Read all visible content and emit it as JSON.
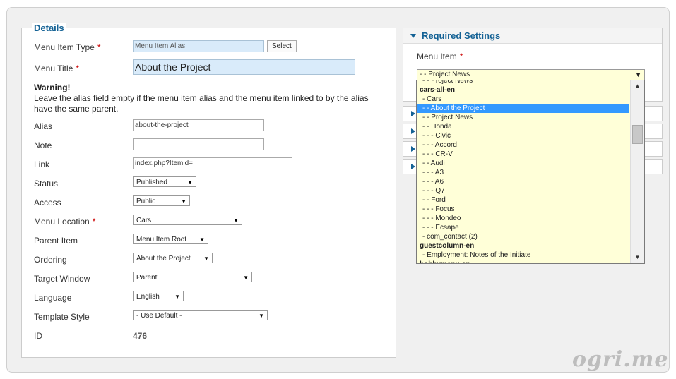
{
  "details": {
    "legend": "Details",
    "menu_item_type": {
      "label": "Menu Item Type",
      "value": "Menu Item Alias",
      "button": "Select"
    },
    "menu_title": {
      "label": "Menu Title",
      "value": "About the Project"
    },
    "warning": {
      "title": "Warning!",
      "text": "Leave the alias field empty if the menu item alias and the menu item linked to by the alias have the same parent."
    },
    "alias": {
      "label": "Alias",
      "value": "about-the-project"
    },
    "note": {
      "label": "Note",
      "value": ""
    },
    "link": {
      "label": "Link",
      "value": "index.php?Itemid="
    },
    "status": {
      "label": "Status",
      "value": "Published"
    },
    "access": {
      "label": "Access",
      "value": "Public"
    },
    "menu_location": {
      "label": "Menu Location",
      "value": "Cars"
    },
    "parent_item": {
      "label": "Parent Item",
      "value": "Menu Item Root"
    },
    "ordering": {
      "label": "Ordering",
      "value": "About the Project"
    },
    "target_window": {
      "label": "Target Window",
      "value": "Parent"
    },
    "language": {
      "label": "Language",
      "value": "English"
    },
    "template_style": {
      "label": "Template Style",
      "value": "- Use Default -"
    },
    "id": {
      "label": "ID",
      "value": "476"
    },
    "required_mark": "*"
  },
  "required_settings": {
    "title": "Required Settings",
    "menu_item_label": "Menu Item",
    "menu_item_value": "- - Project News",
    "dropdown_options": [
      {
        "text": "- - Project News",
        "type": "item"
      },
      {
        "text": "cars-all-en",
        "type": "group"
      },
      {
        "text": "- Cars",
        "type": "item"
      },
      {
        "text": "- - About the Project",
        "type": "selected"
      },
      {
        "text": "- - Project News",
        "type": "item"
      },
      {
        "text": "- - Honda",
        "type": "item"
      },
      {
        "text": "- - - Civic",
        "type": "item"
      },
      {
        "text": "- - - Accord",
        "type": "item"
      },
      {
        "text": "- - - CR-V",
        "type": "item"
      },
      {
        "text": "- - Audi",
        "type": "item"
      },
      {
        "text": "- - - A3",
        "type": "item"
      },
      {
        "text": "- - - A6",
        "type": "item"
      },
      {
        "text": "- - - Q7",
        "type": "item"
      },
      {
        "text": "- - Ford",
        "type": "item"
      },
      {
        "text": "- - - Focus",
        "type": "item"
      },
      {
        "text": "- - - Mondeo",
        "type": "item"
      },
      {
        "text": "- - - Ecsape",
        "type": "item"
      },
      {
        "text": "- com_contact (2)",
        "type": "item"
      },
      {
        "text": "guestcolumn-en",
        "type": "group"
      },
      {
        "text": "- Employment: Notes of the Initiate",
        "type": "item"
      },
      {
        "text": "hobbymenu-en",
        "type": "group"
      }
    ]
  },
  "icons": {
    "dropdown_arrow": "▼",
    "scroll_up": "▲",
    "scroll_down": "▼"
  },
  "watermark": "ogri.me",
  "colors": {
    "heading": "#146295",
    "required": "#cc0000",
    "selected_option": "#3399ff",
    "dropdown_bg": "#ffffd8"
  }
}
